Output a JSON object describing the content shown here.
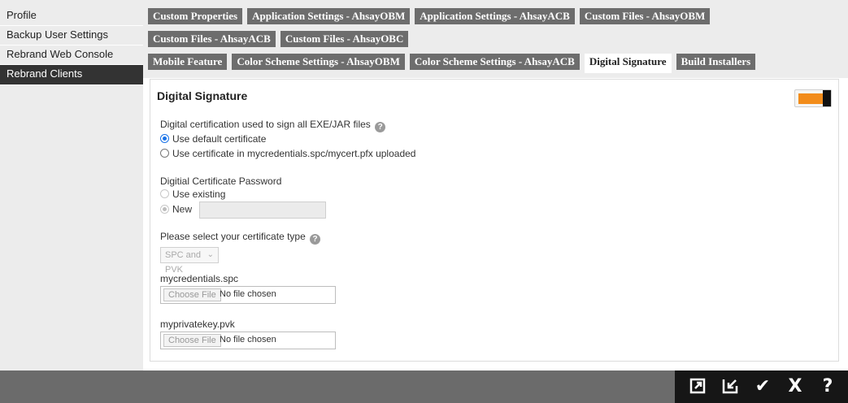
{
  "sidebar": {
    "items": [
      {
        "label": "Profile"
      },
      {
        "label": "Backup User Settings"
      },
      {
        "label": "Rebrand Web Console"
      },
      {
        "label": "Rebrand Clients"
      }
    ]
  },
  "tabs": {
    "row1": [
      "Custom Properties",
      "Application Settings - AhsayOBM",
      "Application Settings - AhsayACB",
      "Custom Files - AhsayOBM"
    ],
    "row2": [
      "Custom Files - AhsayACB",
      "Custom Files - AhsayOBC"
    ],
    "row3": [
      "Mobile Feature",
      "Color Scheme Settings - AhsayOBM",
      "Color Scheme Settings - AhsayACB",
      "Digital Signature",
      "Build Installers"
    ]
  },
  "panel": {
    "title": "Digital Signature",
    "toggle_on": true,
    "cert_label": "Digital certification used to sign all EXE/JAR files",
    "cert_options": [
      "Use default certificate",
      "Use certificate in mycredentials.spc/mycert.pfx uploaded"
    ],
    "pwd_label": "Digitial Certificate Password",
    "pwd_options": [
      "Use existing",
      "New"
    ],
    "type_label": "Please select your certificate type",
    "type_selected": "SPC and PVK",
    "spc_label": "mycredentials.spc",
    "pvk_label": "myprivatekey.pvk",
    "choose_file": "Choose File",
    "no_file": "No file chosen"
  },
  "bottom_bar": {
    "icons": [
      "export-icon",
      "import-icon",
      "check-icon",
      "close-icon",
      "help-icon"
    ],
    "accent": "#f28c1a"
  }
}
